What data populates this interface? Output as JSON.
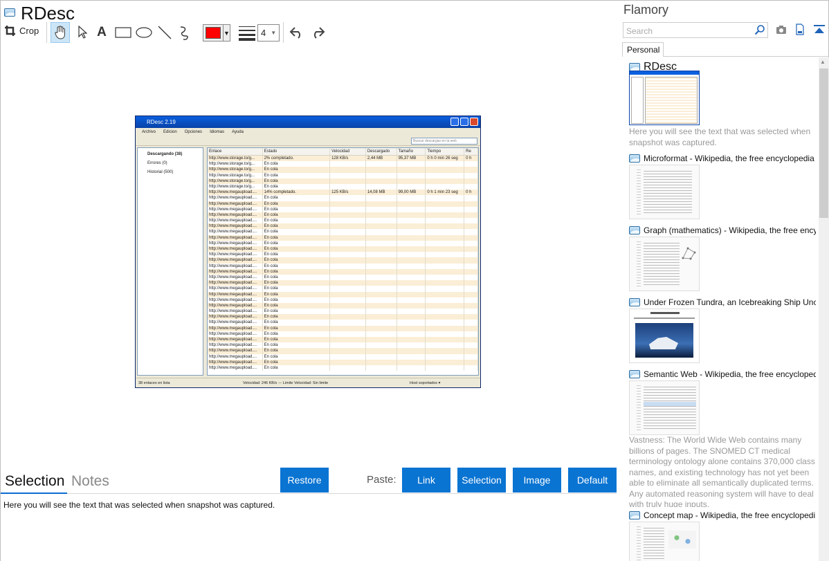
{
  "app": {
    "title": "RDesc"
  },
  "toolbar": {
    "crop_label": "Crop",
    "stroke_width": "4",
    "color": "#ff0000"
  },
  "screenshot": {
    "window_title": "RDesc 2.19",
    "menu": [
      "Archivo",
      "Edicion",
      "Opciones",
      "Idiomas",
      "Ayuda"
    ],
    "search_placeholder": "Buscar descargas en la web",
    "tree": [
      "Descargando (38)",
      "Errores (0)",
      "Historial (500)"
    ],
    "columns": [
      "Enlace",
      "Estado",
      "Velocidad",
      "Descargado",
      "Tamaño",
      "Tiempo",
      "Re"
    ],
    "rows": [
      [
        "http://www.storage.to/g...",
        "2% completado.",
        "128 KB/s",
        "2,44 MB",
        "95,37 MB",
        "0 h 0 min 26 seg",
        "0 h"
      ],
      [
        "http://www.storage.to/g...",
        "En cola",
        "",
        "",
        "",
        "",
        ""
      ],
      [
        "http://www.storage.to/g...",
        "En cola",
        "",
        "",
        "",
        "",
        ""
      ],
      [
        "http://www.storage.to/g...",
        "En cola",
        "",
        "",
        "",
        "",
        ""
      ],
      [
        "http://www.storage.to/g...",
        "En cola",
        "",
        "",
        "",
        "",
        ""
      ],
      [
        "http://www.storage.to/g...",
        "En cola",
        "",
        "",
        "",
        "",
        ""
      ],
      [
        "http://www.megaupload....",
        "14% completado.",
        "125 KB/s",
        "14,08 MB",
        "99,00 MB",
        "0 h 1 min 23 seg",
        "0 h"
      ],
      [
        "http://www.megaupload....",
        "En cola",
        "",
        "",
        "",
        "",
        ""
      ],
      [
        "http://www.megaupload....",
        "En cola",
        "",
        "",
        "",
        "",
        ""
      ],
      [
        "http://www.megaupload....",
        "En cola",
        "",
        "",
        "",
        "",
        ""
      ],
      [
        "http://www.megaupload....",
        "En cola",
        "",
        "",
        "",
        "",
        ""
      ],
      [
        "http://www.megaupload....",
        "En cola",
        "",
        "",
        "",
        "",
        ""
      ],
      [
        "http://www.megaupload....",
        "En cola",
        "",
        "",
        "",
        "",
        ""
      ],
      [
        "http://www.megaupload....",
        "En cola",
        "",
        "",
        "",
        "",
        ""
      ],
      [
        "http://www.megaupload....",
        "En cola",
        "",
        "",
        "",
        "",
        ""
      ],
      [
        "http://www.megaupload....",
        "En cola",
        "",
        "",
        "",
        "",
        ""
      ],
      [
        "http://www.megaupload....",
        "En cola",
        "",
        "",
        "",
        "",
        ""
      ],
      [
        "http://www.megaupload....",
        "En cola",
        "",
        "",
        "",
        "",
        ""
      ],
      [
        "http://www.megaupload....",
        "En cola",
        "",
        "",
        "",
        "",
        ""
      ],
      [
        "http://www.megaupload....",
        "En cola",
        "",
        "",
        "",
        "",
        ""
      ],
      [
        "http://www.megaupload....",
        "En cola",
        "",
        "",
        "",
        "",
        ""
      ],
      [
        "http://www.megaupload....",
        "En cola",
        "",
        "",
        "",
        "",
        ""
      ],
      [
        "http://www.megaupload....",
        "En cola",
        "",
        "",
        "",
        "",
        ""
      ],
      [
        "http://www.megaupload....",
        "En cola",
        "",
        "",
        "",
        "",
        ""
      ],
      [
        "http://www.megaupload....",
        "En cola",
        "",
        "",
        "",
        "",
        ""
      ],
      [
        "http://www.megaupload....",
        "En cola",
        "",
        "",
        "",
        "",
        ""
      ],
      [
        "http://www.megaupload....",
        "En cola",
        "",
        "",
        "",
        "",
        ""
      ],
      [
        "http://www.megaupload....",
        "En cola",
        "",
        "",
        "",
        "",
        ""
      ],
      [
        "http://www.megaupload....",
        "En cola",
        "",
        "",
        "",
        "",
        ""
      ],
      [
        "http://www.megaupload....",
        "En cola",
        "",
        "",
        "",
        "",
        ""
      ],
      [
        "http://www.megaupload....",
        "En cola",
        "",
        "",
        "",
        "",
        ""
      ],
      [
        "http://www.megaupload....",
        "En cola",
        "",
        "",
        "",
        "",
        ""
      ],
      [
        "http://www.megaupload....",
        "En cola",
        "",
        "",
        "",
        "",
        ""
      ],
      [
        "http://www.megaupload....",
        "En cola",
        "",
        "",
        "",
        "",
        ""
      ],
      [
        "http://www.megaupload....",
        "En cola",
        "",
        "",
        "",
        "",
        ""
      ],
      [
        "http://www.megaupload....",
        "En cola",
        "",
        "",
        "",
        "",
        ""
      ],
      [
        "http://www.megaupload....",
        "En cola",
        "",
        "",
        "",
        "",
        ""
      ],
      [
        "http://www.megaupload....",
        "En cola",
        "",
        "",
        "",
        "",
        ""
      ]
    ],
    "status_left": "38 enlaces en lista",
    "status_mid": "Velocidad: 246 KB/s  ---  Limite Velocidad: Sin limite",
    "status_right": "Host soportados  ▾"
  },
  "bottom": {
    "tabs": [
      "Selection",
      "Notes"
    ],
    "restore": "Restore",
    "paste_label": "Paste:",
    "paste_buttons": [
      "Link",
      "Selection",
      "Image",
      "Default"
    ],
    "selection_text": "Here you will see the text that was selected when snapshot was captured."
  },
  "sidebar": {
    "title": "Flamory",
    "search_placeholder": "Search",
    "tab": "Personal",
    "entries": [
      {
        "title": "RDesc",
        "desc": "Here you will see the text that was selected when snapshot was captured."
      },
      {
        "title": "Microformat - Wikipedia, the free encyclopedia"
      },
      {
        "title": "Graph (mathematics) - Wikipedia, the free ency"
      },
      {
        "title": "Under Frozen Tundra, an Icebreaking Ship Unco"
      },
      {
        "title": "Semantic Web - Wikipedia, the free encycloped",
        "desc": "Vastness: The World Wide Web contains many billions of pages. The SNOMED CT medical terminology ontology alone contains 370,000 class names, and existing technology has not yet been able to eliminate all semantically duplicated terms. Any automated reasoning system will have to deal with truly huge inputs."
      },
      {
        "title": "Concept map - Wikipedia, the free encyclopedi"
      }
    ]
  }
}
